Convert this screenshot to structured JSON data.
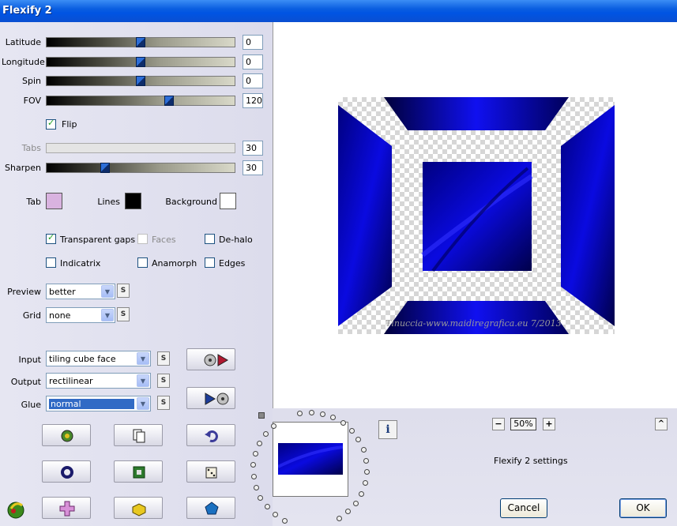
{
  "window": {
    "title": "Flexify 2"
  },
  "sliders": [
    {
      "label": "Latitude",
      "value": "0",
      "fraction": 0.5,
      "enabled": true
    },
    {
      "label": "Longitude",
      "value": "0",
      "fraction": 0.5,
      "enabled": true
    },
    {
      "label": "Spin",
      "value": "0",
      "fraction": 0.5,
      "enabled": true
    },
    {
      "label": "FOV",
      "value": "120",
      "fraction": 0.66,
      "enabled": true
    },
    {
      "label": "Tabs",
      "value": "30",
      "fraction": 0,
      "enabled": false
    },
    {
      "label": "Sharpen",
      "value": "30",
      "fraction": 0.3,
      "enabled": true
    }
  ],
  "flip": {
    "label": "Flip",
    "checked": true
  },
  "colors": {
    "tab": {
      "label": "Tab",
      "hex": "#d9b3e0"
    },
    "lines": {
      "label": "Lines",
      "hex": "#000000"
    },
    "background": {
      "label": "Background",
      "hex": "#ffffff"
    }
  },
  "options": {
    "transparent_gaps": {
      "label": "Transparent gaps",
      "checked": true
    },
    "faces": {
      "label": "Faces",
      "checked": false,
      "enabled": false
    },
    "de_halo": {
      "label": "De-halo",
      "checked": false
    },
    "indicatrix": {
      "label": "Indicatrix",
      "checked": false
    },
    "anamorph": {
      "label": "Anamorph",
      "checked": false
    },
    "edges": {
      "label": "Edges",
      "checked": false
    }
  },
  "preview_select": {
    "label": "Preview",
    "value": "better",
    "s_label": "S"
  },
  "grid_select": {
    "label": "Grid",
    "value": "none",
    "s_label": "S"
  },
  "input_select": {
    "label": "Input",
    "value": "tiling cube face",
    "s_label": "S"
  },
  "output_select": {
    "label": "Output",
    "value": "rectilinear",
    "s_label": "S"
  },
  "glue_select": {
    "label": "Glue",
    "value": "normal",
    "s_label": "S"
  },
  "preview": {
    "watermark": "Tinuccia-www.maidiregrafica.eu 7/2013",
    "zoom": "50%",
    "zoom_minus": "−",
    "zoom_plus": "+",
    "collapse": "^"
  },
  "info_button": {
    "label": "i"
  },
  "status": {
    "settings_text": "Flexify 2 settings"
  },
  "buttons": {
    "cancel": "Cancel",
    "ok": "OK"
  },
  "accent_colors": {
    "cube_blue": "#0a0acc",
    "title_blue": "#0054e3"
  }
}
